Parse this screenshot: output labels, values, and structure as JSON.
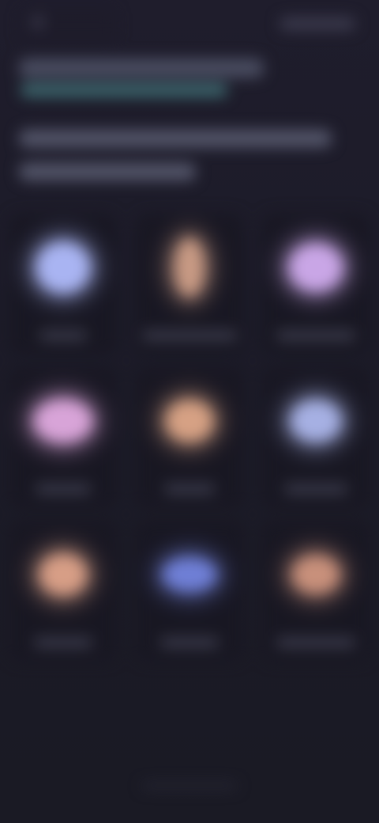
{
  "status_bar": {
    "left_icon": "app-icon",
    "right_icons": "system-status-icons"
  },
  "header": {
    "title": "",
    "subtitle": ""
  },
  "intro": {
    "line1": "",
    "line2": ""
  },
  "grid": {
    "tiles": [
      {
        "label": "",
        "color": "#a9b4f2",
        "icon": "blue-orb-icon"
      },
      {
        "label": "",
        "color": "#c89a84",
        "icon": "figure-icon"
      },
      {
        "label": "",
        "color": "#c9a6e6",
        "icon": "purple-orb-icon"
      },
      {
        "label": "",
        "color": "#d8a4d8",
        "icon": "pink-orb-icon"
      },
      {
        "label": "",
        "color": "#d6a184",
        "icon": "peach-orb-icon"
      },
      {
        "label": "",
        "color": "#a6b0e3",
        "icon": "light-blue-orb-icon"
      },
      {
        "label": "",
        "color": "#d79e86",
        "icon": "orange-orb-icon"
      },
      {
        "label": "",
        "color": "#6f7fd6",
        "icon": "indigo-orb-icon"
      },
      {
        "label": "",
        "color": "#c8907b",
        "icon": "amber-orb-icon"
      }
    ]
  },
  "background_color": "#1b1b27"
}
